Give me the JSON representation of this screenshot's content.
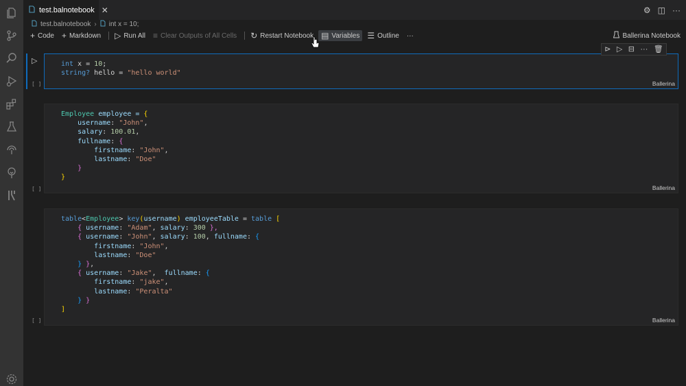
{
  "tab": {
    "label": "test.balnotebook",
    "close": "✕"
  },
  "breadcrumb": {
    "file": "test.balnotebook",
    "cell": "int x = 10;",
    "separator": "›"
  },
  "toolbar": {
    "code": "Code",
    "markdown": "Markdown",
    "run_all": "Run All",
    "clear_outputs": "Clear Outputs of All Cells",
    "restart": "Restart Notebook",
    "variables": "Variables",
    "outline": "Outline",
    "more": "···",
    "kernel": "Ballerina Notebook"
  },
  "cells": [
    {
      "exec": "[ ]",
      "lang": "Ballerina"
    },
    {
      "exec": "[ ]",
      "lang": "Ballerina"
    },
    {
      "exec": "[ ]",
      "lang": "Ballerina"
    }
  ],
  "code": {
    "c1": {
      "l1": [
        "int",
        " x = ",
        "10",
        ";"
      ],
      "l2": [
        "string?",
        " hello = ",
        "\"hello world\""
      ]
    },
    "c2": {
      "l1": [
        "Employee",
        " employee = ",
        "{"
      ],
      "l2": [
        "username",
        ": ",
        "\"John\"",
        ","
      ],
      "l3": [
        "salary",
        ": ",
        "100.01",
        ","
      ],
      "l4": [
        "fullname",
        ": ",
        "{"
      ],
      "l5": [
        "firstname",
        ": ",
        "\"John\"",
        ","
      ],
      "l6": [
        "lastname",
        ": ",
        "\"Doe\""
      ],
      "l7": [
        "}"
      ],
      "l8": [
        "}"
      ]
    },
    "c3": {
      "l1": [
        "table",
        "<",
        "Employee",
        "> ",
        "key",
        "(",
        "username",
        ") ",
        "employeeTable",
        " = ",
        "table",
        " ["
      ],
      "l2": [
        "{ ",
        "username",
        ": ",
        "\"Adam\"",
        ", ",
        "salary",
        ": ",
        "300",
        " },"
      ],
      "l3": [
        "{ ",
        "username",
        ": ",
        "\"John\"",
        ", ",
        "salary",
        ": ",
        "100",
        ", ",
        "fullname",
        ": ",
        "{"
      ],
      "l4": [
        "firstname",
        ": ",
        "\"John\"",
        ","
      ],
      "l5": [
        "lastname",
        ": ",
        "\"Doe\""
      ],
      "l6": [
        "} ",
        "}",
        ","
      ],
      "l7": [
        "{ ",
        "username",
        ": ",
        "\"Jake\"",
        ",  ",
        "fullname",
        ": ",
        "{"
      ],
      "l8": [
        "firstname",
        ": ",
        "\"jake\"",
        ","
      ],
      "l9": [
        "lastname",
        ": ",
        "\"Peralta\""
      ],
      "l10": [
        "} ",
        "}"
      ],
      "l11": [
        "]"
      ]
    }
  },
  "icons": {
    "activity": [
      "explorer-icon",
      "source-control-icon",
      "search-icon",
      "run-debug-icon",
      "extensions-icon",
      "testing-icon",
      "remote-icon",
      "tree-icon",
      "ballerina-icon",
      "settings-gear-icon"
    ]
  },
  "colors": {
    "accent": "#0f6cbd",
    "keyword": "#569cd6",
    "string": "#ce9178",
    "number": "#b5cea8",
    "property": "#9cdcfe",
    "type": "#4ec9b0"
  }
}
